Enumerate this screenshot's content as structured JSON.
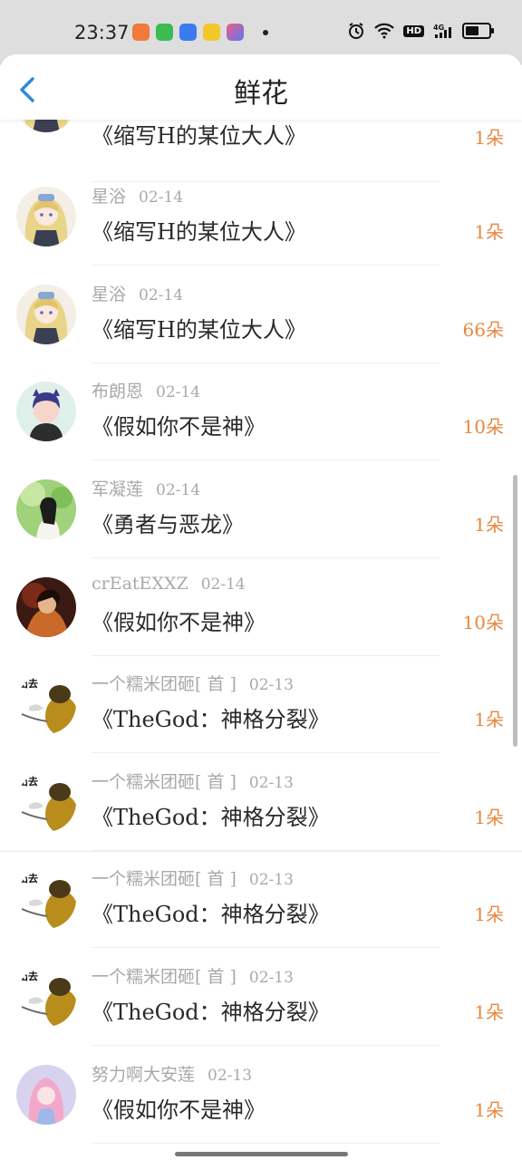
{
  "status_bar": {
    "time": "23:37"
  },
  "header": {
    "title": "鲜花"
  },
  "items": [
    {
      "user": "",
      "date": "",
      "book": "《缩写H的某位大人》",
      "count": "1朵",
      "avatar": "anime"
    },
    {
      "user": "星浴",
      "date": "02-14",
      "book": "《缩写H的某位大人》",
      "count": "1朵",
      "avatar": "anime"
    },
    {
      "user": "星浴",
      "date": "02-14",
      "book": "《缩写H的某位大人》",
      "count": "66朵",
      "avatar": "anime"
    },
    {
      "user": "布朗恩",
      "date": "02-14",
      "book": "《假如你不是神》",
      "count": "10朵",
      "avatar": "cat"
    },
    {
      "user": "军凝莲",
      "date": "02-14",
      "book": "《勇者与恶龙》",
      "count": "1朵",
      "avatar": "nature"
    },
    {
      "user": "crEatEXXZ",
      "date": "02-14",
      "book": "《假如你不是神》",
      "count": "10朵",
      "avatar": "dark"
    },
    {
      "user": "一个糯米团砸[ 首 ]",
      "date": "02-13",
      "book": "《TheGod：神格分裂》",
      "count": "1朵",
      "avatar": "duck"
    },
    {
      "user": "一个糯米团砸[ 首 ]",
      "date": "02-13",
      "book": "《TheGod：神格分裂》",
      "count": "1朵",
      "avatar": "duck"
    },
    {
      "user": "一个糯米团砸[ 首 ]",
      "date": "02-13",
      "book": "《TheGod：神格分裂》",
      "count": "1朵",
      "avatar": "duck"
    },
    {
      "user": "一个糯米团砸[ 首 ]",
      "date": "02-13",
      "book": "《TheGod：神格分裂》",
      "count": "1朵",
      "avatar": "duck"
    },
    {
      "user": "努力啊大安莲",
      "date": "02-13",
      "book": "《假如你不是神》",
      "count": "1朵",
      "avatar": "pink"
    }
  ],
  "colors": {
    "accent": "#e8873f",
    "back_arrow": "#2f8bdc",
    "muted": "#a9a9a9"
  },
  "icons": [
    "back-arrow-icon",
    "alarm-icon",
    "wifi-icon",
    "hd-icon",
    "signal-4g-icon",
    "battery-icon"
  ]
}
